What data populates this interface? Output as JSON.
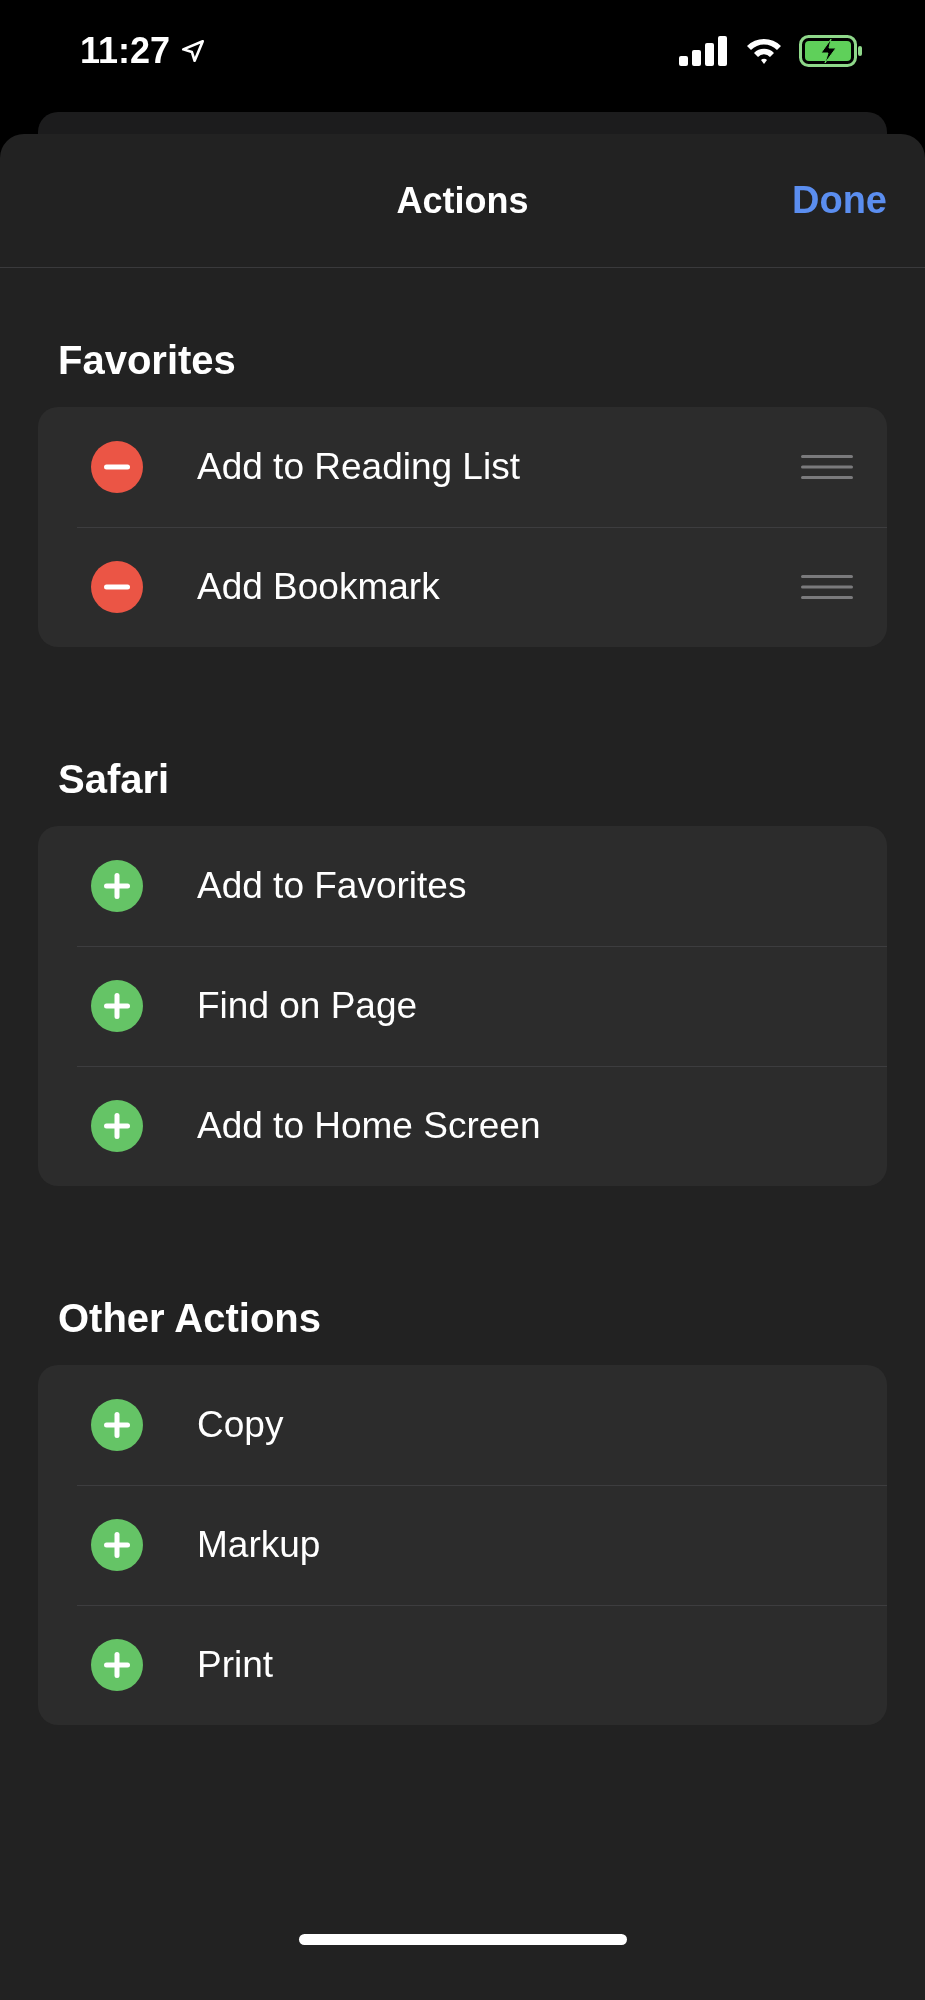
{
  "status_bar": {
    "time": "11:27"
  },
  "header": {
    "title": "Actions",
    "done": "Done"
  },
  "sections": [
    {
      "title": "Favorites",
      "items": [
        {
          "label": "Add to Reading List",
          "kind": "remove"
        },
        {
          "label": "Add Bookmark",
          "kind": "remove"
        }
      ]
    },
    {
      "title": "Safari",
      "items": [
        {
          "label": "Add to Favorites",
          "kind": "add"
        },
        {
          "label": "Find on Page",
          "kind": "add"
        },
        {
          "label": "Add to Home Screen",
          "kind": "add"
        }
      ]
    },
    {
      "title": "Other Actions",
      "items": [
        {
          "label": "Copy",
          "kind": "add"
        },
        {
          "label": "Markup",
          "kind": "add"
        },
        {
          "label": "Print",
          "kind": "add"
        }
      ]
    }
  ]
}
